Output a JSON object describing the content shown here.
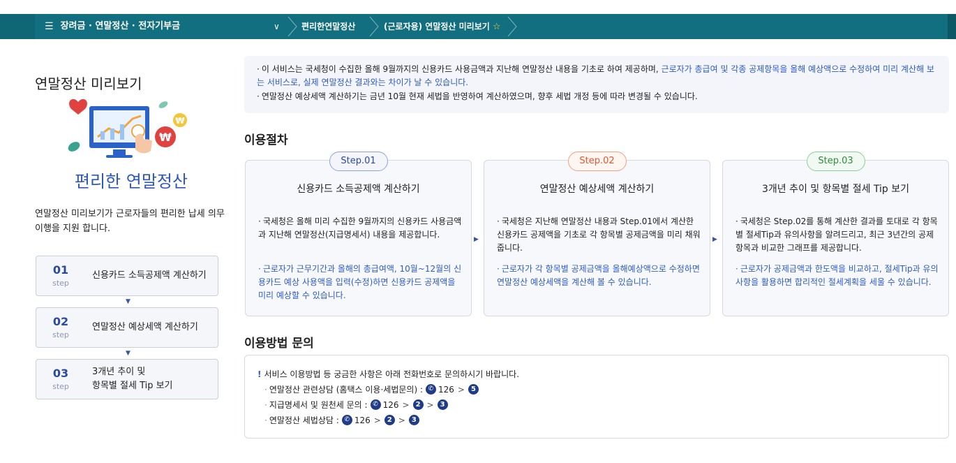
{
  "breadcrumb": {
    "menu_icon": "hamburger-icon",
    "menu_label": "장려금 · 연말정산 · 전자기부금",
    "dropdown_icon": "chevron-down-icon",
    "item1": "편리한연말정산",
    "item2": "(근로자용) 연말정산 미리보기",
    "star_icon": "star-icon"
  },
  "sidebar": {
    "title": "연말정산 미리보기",
    "illustration_icon": "monitor-chart-illustration",
    "brand": "편리한 연말정산",
    "description": "연말정산 미리보기가 근로자들의  편리한 납세 의무 이행을 지원 합니다.",
    "steps": [
      {
        "num": "01",
        "label": "step",
        "text": "신용카드 소득공제액 계산하기"
      },
      {
        "num": "02",
        "label": "step",
        "text": "연말정산 예상세액 계산하기"
      },
      {
        "num": "03",
        "label": "step",
        "text": "3개년 추이 및",
        "text2": "항목별 절세 Tip 보기"
      }
    ]
  },
  "notice": {
    "line1_a": "이 서비스는 국세청이 수집한 올해 9월까지의 신용카드 사용금액과 지난해 연말정산 내용을 기초로 하여 제공하며, ",
    "line1_b": "근로자가 총급여 및 각종 공제항목을 올해 예상액으로 수정하여 미리 계산해 보는 서비스로, 실제 연말정산 결과와는 차이가 날 수 있습니다.",
    "line2": "연말정산 예상세액 계산하기는 금년 10월 현재 세법을 반영하여 계산하였으며, 향후 세법 개정 등에 따라 변경될 수 있습니다."
  },
  "procedure": {
    "title": "이용절차",
    "steps": [
      {
        "pill": "Step.01",
        "title": "신용카드 소득공제액 계산하기",
        "body1": "국세청은 올해 미리 수집한 9월까지의 신용카드 사용금액과 지난해 연말정산(지급명세서) 내용을 제공합니다.",
        "body2": "근로자가 근무기간과 올해의 총급여액, 10월~12월의 신용카드 예상 사용액을 입력(수정)하면 신용카드 공제액을 미리 예상할 수 있습니다."
      },
      {
        "pill": "Step.02",
        "title": "연말정산 예상세액 계산하기",
        "body1": "국세청은 지난해 연말정산 내용과 Step.01에서 계산한 신용카드 공제액을 기초로 각 항목별 공제금액을 미리 채워줍니다.",
        "body2": "근로자가 각 항목별 공제금액을 올해예상액으로 수정하면 연말정산 예상세액을 계산해 볼 수 있습니다."
      },
      {
        "pill": "Step.03",
        "title": "3개년 추이 및 항목별 절세 Tip 보기",
        "body1": "국세청은 Step.02를 통해 계산한 결과를 토대로 각 항목별 절세Tip과 유의사항을 알려드리고, 최근 3년간의 공제항목과 비교한 그래프를 제공합니다.",
        "body2": "근로자가 공제금액과 한도액을 비교하고, 절세Tip과 유의사항을 활용하면 합리적인 절세계획을 세울 수 있습니다."
      }
    ],
    "colors": {
      "step1": "#2b4a9c",
      "step2": "#e2572c",
      "step3": "#2f8a3a"
    }
  },
  "inquiry": {
    "title": "이용방법 문의",
    "lead_mark": "!",
    "lead": "서비스 이용방법 등 궁금한 사항은 아래 전화번호로 문의하시기 바랍니다.",
    "rows": [
      {
        "label": "연말정산 관련상담 (홈택스 이용·세법문의) :",
        "number": "126",
        "codes": [
          "5"
        ]
      },
      {
        "label": "지급명세서 및 원천세 문의 :",
        "number": "126",
        "codes": [
          "2",
          "3"
        ]
      },
      {
        "label": "연말정산 세법상담 :",
        "number": "126",
        "codes": [
          "2",
          "3"
        ]
      }
    ],
    "phone_icon": "phone-icon"
  }
}
